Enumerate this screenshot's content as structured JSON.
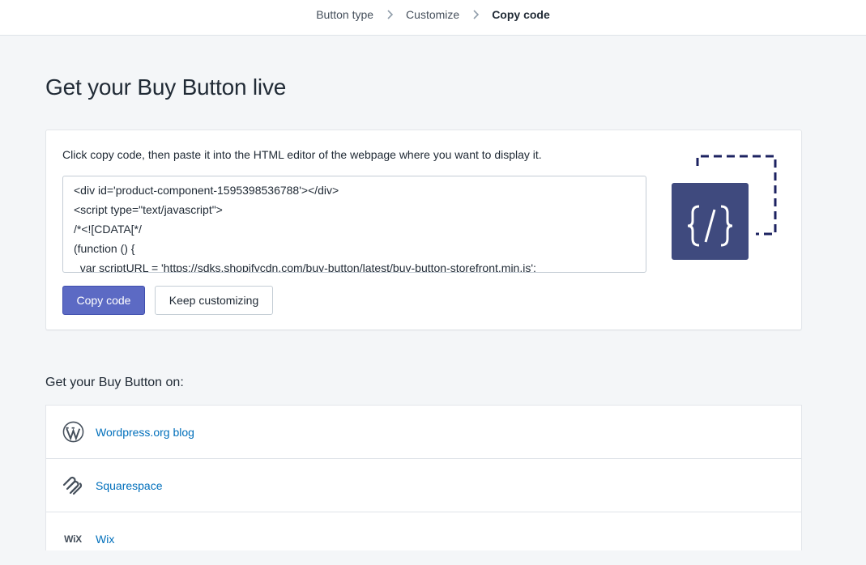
{
  "breadcrumb": {
    "items": [
      "Button type",
      "Customize",
      "Copy code"
    ],
    "active_index": 2
  },
  "page": {
    "title": "Get your Buy Button live"
  },
  "code_card": {
    "instructions": "Click copy code, then paste it into the HTML editor of the webpage where you want to display it.",
    "code_lines": [
      "<div id='product-component-1595398536788'></div>",
      "<script type=\"text/javascript\">",
      "/*<![CDATA[*/",
      "(function () {",
      "  var scriptURL = 'https://sdks.shopifycdn.com/buy-button/latest/buy-button-storefront.min.js';"
    ],
    "copy_button": "Copy code",
    "keep_button": "Keep customizing",
    "illustration_icon": "code-braces-icon"
  },
  "platforms": {
    "title": "Get your Buy Button on:",
    "items": [
      {
        "label": "Wordpress.org blog",
        "icon": "wordpress-icon"
      },
      {
        "label": "Squarespace",
        "icon": "squarespace-icon"
      },
      {
        "label": "Wix",
        "icon": "wix-icon",
        "icon_text": "WiX"
      }
    ]
  },
  "colors": {
    "primary": "#5c6ac4",
    "illustration_navy": "#3f4a7e",
    "link": "#006fbb",
    "background": "#f4f6f8"
  }
}
